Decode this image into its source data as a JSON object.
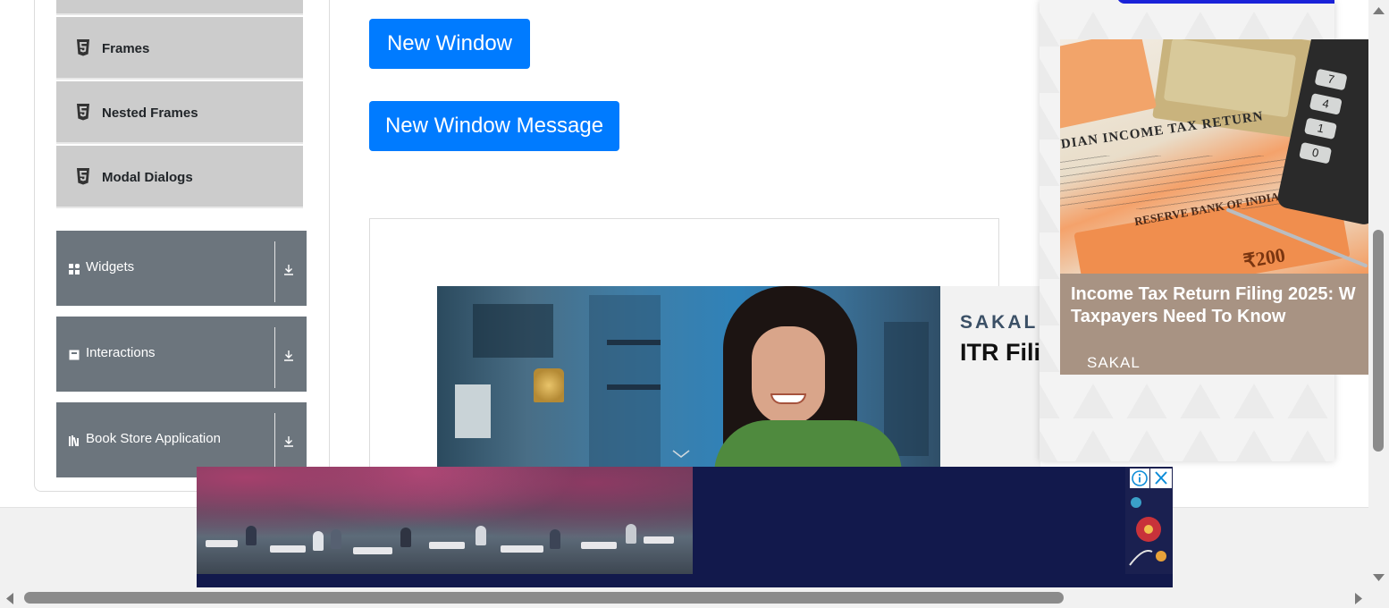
{
  "sidebar": {
    "frames_submenu": [
      {
        "label": "Frames",
        "icon": "html5-icon"
      },
      {
        "label": "Nested Frames",
        "icon": "html5-icon"
      },
      {
        "label": "Modal Dialogs",
        "icon": "html5-icon"
      }
    ],
    "groups": [
      {
        "label": "Widgets",
        "icon": "grid-icon"
      },
      {
        "label": "Interactions",
        "icon": "square-icon"
      },
      {
        "label": "Book Store Application",
        "icon": "books-icon"
      }
    ]
  },
  "main": {
    "new_window_button": "New Window",
    "new_window_message_button": "New Window Message"
  },
  "inline_ad": {
    "brand": "SAKAL",
    "headline": "ITR Fili"
  },
  "side_ad": {
    "title_line1": "Income Tax Return Filing 2025: W",
    "title_line2": "Taxpayers Need To Know",
    "source": "SAKAL",
    "image_text": {
      "doc_title": "DIAN INCOME TAX RETURN",
      "note_text": "RESERVE BANK OF INDIA",
      "note_value": "₹200",
      "calc_keys": [
        "7",
        "4",
        "1",
        "0"
      ]
    }
  },
  "banner_ad": {
    "info_label": "ⓘ",
    "close_label": "✕"
  },
  "colors": {
    "primary_button": "#007bff",
    "sidebar_group": "#6c757d",
    "sidebar_subitem": "#cccccc",
    "banner_bg": "#12194c"
  }
}
